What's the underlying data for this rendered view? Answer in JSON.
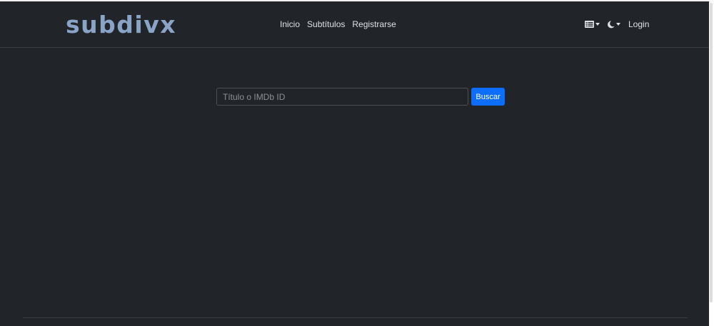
{
  "navbar": {
    "brand": "subdivx",
    "links": [
      "Inicio",
      "Subtítulos",
      "Registrarse"
    ],
    "layout_toggle_icon": "list-layout-icon",
    "theme_toggle_icon": "moon-icon",
    "login_label": "Login"
  },
  "search": {
    "placeholder": "Título o IMDb ID",
    "value": "",
    "button_label": "Buscar"
  },
  "colors": {
    "background": "#212529",
    "brand": "#8aa4c8",
    "text": "#dee2e6",
    "accent": "#0d6efd"
  }
}
